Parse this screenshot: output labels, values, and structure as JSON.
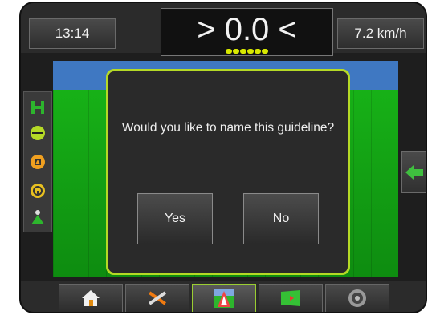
{
  "status": {
    "time": "13:14",
    "cross_track": "> 0.0 <",
    "speed": "7.2 km/h",
    "led_count": 6
  },
  "dialog": {
    "message": "Would you like to name this guideline?",
    "yes_label": "Yes",
    "no_label": "No"
  },
  "sidebar": {
    "icons": [
      "guidance-mode-icon",
      "boundary-icon",
      "field-marker-icon",
      "steering-icon",
      "vehicle-view-icon"
    ]
  },
  "bottom_tabs": [
    "home-icon",
    "tools-icon",
    "guidance-icon",
    "map-icon",
    "camera-icon"
  ],
  "colors": {
    "accent": "#b5d926",
    "led": "#d8e800",
    "field": "#17b117",
    "sky": "#3f78c2"
  }
}
